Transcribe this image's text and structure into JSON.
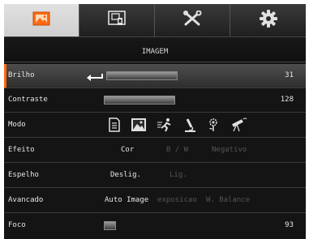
{
  "tabs": [
    {
      "icon": "image-settings-icon",
      "active": true
    },
    {
      "icon": "presentation-icon",
      "active": false
    },
    {
      "icon": "tools-icon",
      "active": false
    },
    {
      "icon": "gear-icon",
      "active": false
    }
  ],
  "header": {
    "title": "IMAGEM"
  },
  "rows": {
    "brilho": {
      "label": "Brilho",
      "value": "31"
    },
    "contraste": {
      "label": "Contraste",
      "value": "128"
    },
    "modo": {
      "label": "Modo",
      "icons": [
        "document-icon",
        "photo-icon",
        "motion-icon",
        "microscope-icon",
        "gear-flower-icon",
        "telescope-icon"
      ]
    },
    "efeito": {
      "label": "Efeito",
      "options": [
        "Cor",
        "B / W",
        "Negativo"
      ],
      "selected": "Cor"
    },
    "espelho": {
      "label": "Espelho",
      "options": [
        "Deslig.",
        "Lig."
      ],
      "selected": "Deslig."
    },
    "avancado": {
      "label": "Avancado",
      "options": [
        "Auto Image",
        "exposicao",
        "W. Balance"
      ],
      "selected": "Auto Image"
    },
    "foco": {
      "label": "Foco",
      "value": "93"
    }
  },
  "colors": {
    "accent": "#ff6a13",
    "active_tab": "#d8d8d8",
    "background": "#141414",
    "disabled_text": "#555555"
  }
}
